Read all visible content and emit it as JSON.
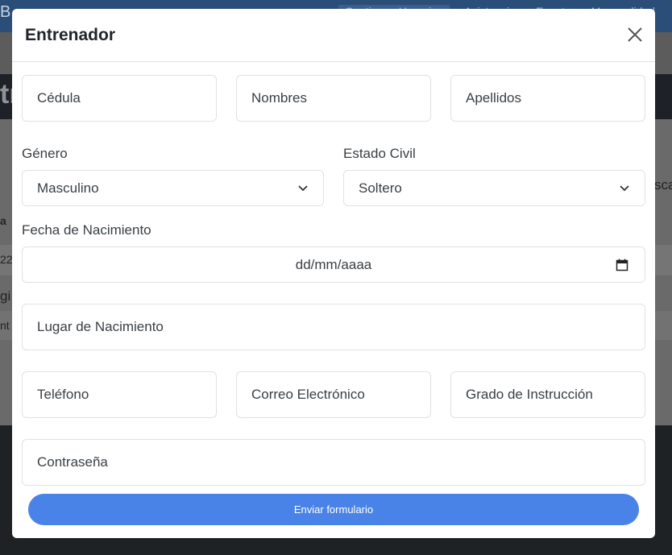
{
  "background": {
    "logo_fragment": "B",
    "nav_items": [
      "Gestiones Usuarios",
      "Asistencias",
      "Eventos",
      "Mensualidad"
    ],
    "hero_fragment": "tr",
    "fragments": [
      "a",
      "22",
      "gi",
      "nt",
      "sca"
    ]
  },
  "modal": {
    "title": "Entrenador",
    "close_icon": "close-icon",
    "fields": {
      "cedula": "Cédula",
      "nombres": "Nombres",
      "apellidos": "Apellidos",
      "genero_label": "Género",
      "genero_value": "Masculino",
      "estado_civil_label": "Estado Civil",
      "estado_civil_value": "Soltero",
      "fecha_label": "Fecha de Nacimiento",
      "fecha_value": "dd/mm/aaaa",
      "lugar": "Lugar de Nacimiento",
      "telefono": "Teléfono",
      "correo": "Correo Electrónico",
      "grado": "Grado de Instrucción",
      "contrasena": "Contraseña"
    },
    "submit_label": "Enviar formulario"
  },
  "colors": {
    "accent": "#4a83e8",
    "overlay": "#5c5c5c"
  }
}
